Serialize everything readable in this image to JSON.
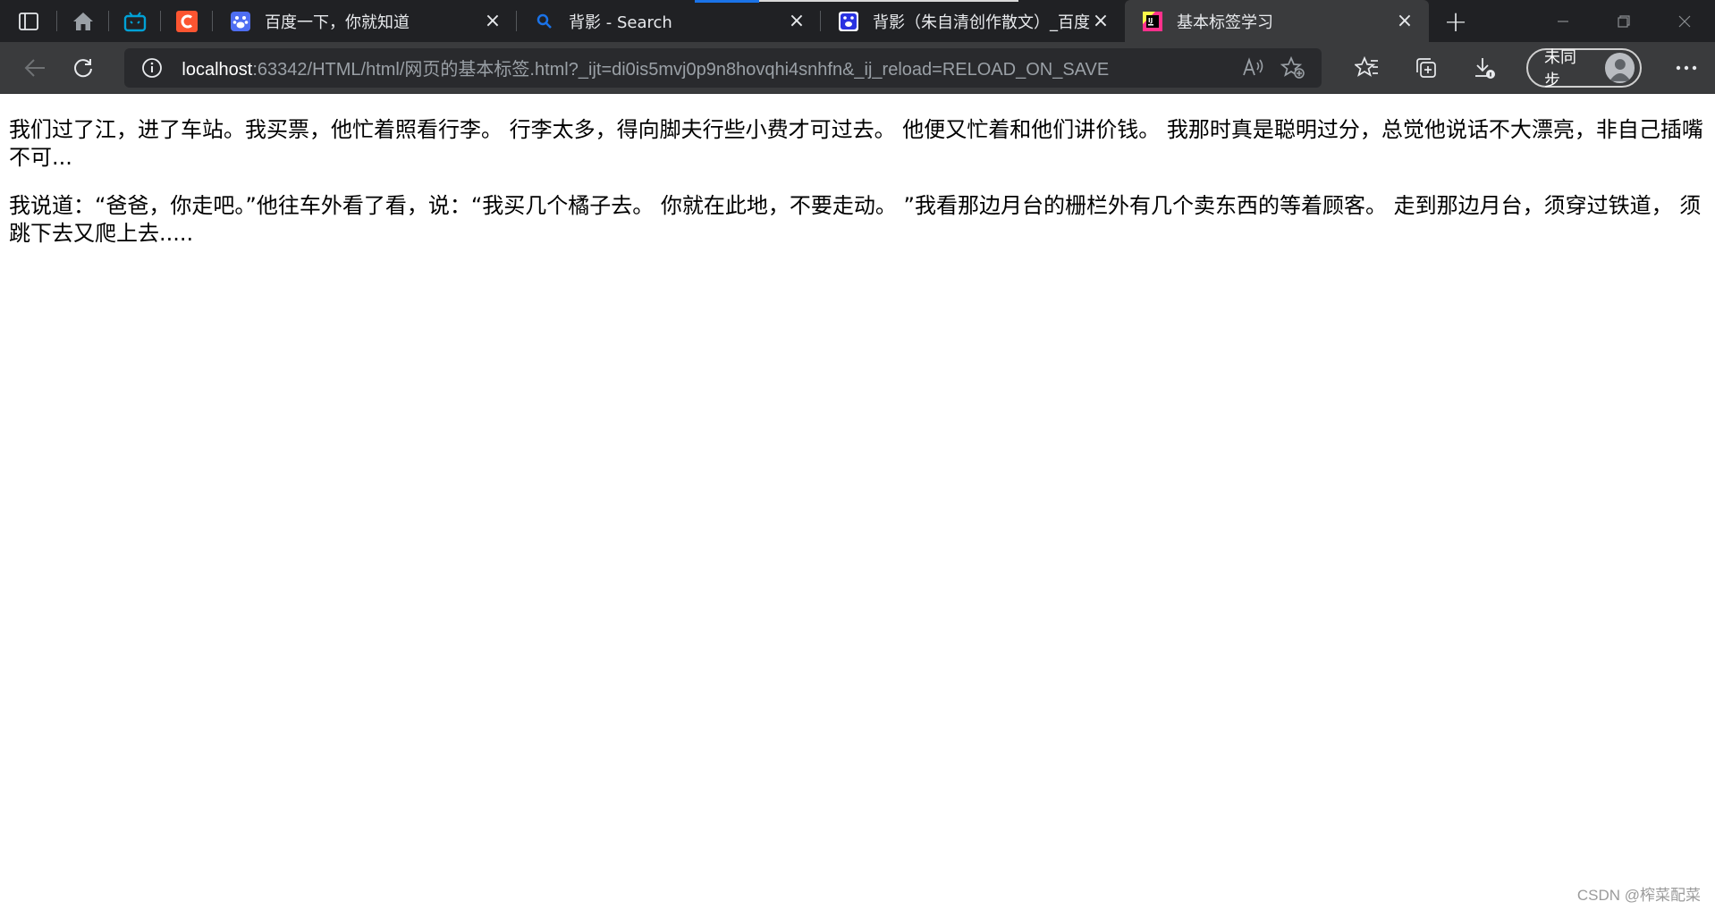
{
  "tabs": [
    {
      "title": "百度一下，你就知道",
      "icon": "baidu-paw-icon"
    },
    {
      "title": "背影 - Search",
      "icon": "search-icon"
    },
    {
      "title": "背影（朱自清创作散文）_百度",
      "icon": "baidu-du-icon"
    },
    {
      "title": "基本标签学习",
      "icon": "jetbrains-icon",
      "active": true
    }
  ],
  "pinned": [
    "home-icon",
    "bilibili-icon",
    "csdn-icon"
  ],
  "address": {
    "host": "localhost",
    "rest": ":63342/HTML/html/网页的基本标签.html?_ijt=di0is5mvj0p9n8hovqhi4snhfn&_ij_reload=RELOAD_ON_SAVE"
  },
  "profile": {
    "label": "未同步"
  },
  "page": {
    "paragraphs": [
      "我们过了江，进了车站。我买票，他忙着照看行李。 行李太多，得向脚夫行些小费才可过去。 他便又忙着和他们讲价钱。 我那时真是聪明过分，总觉他说话不大漂亮，非自己插嘴不可...",
      "我说道：“爸爸，你走吧。”他往车外看了看，说：“我买几个橘子去。 你就在此地，不要走动。 ”我看那边月台的栅栏外有几个卖东西的等着顾客。 走到那边月台，须穿过铁道， 须跳下去又爬上去....."
    ]
  },
  "watermark": "CSDN @榨菜配菜",
  "colors": {
    "tabstrip": "#202124",
    "toolbar": "#3a3b3d",
    "omnibox": "#292a2d",
    "accent": "#1a73e8"
  }
}
